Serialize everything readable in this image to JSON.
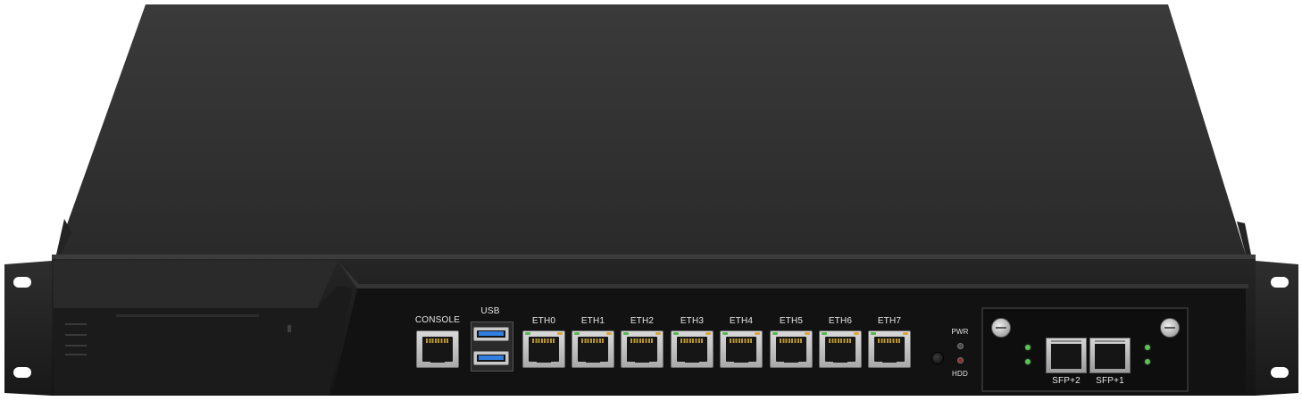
{
  "device": {
    "port_labels": {
      "console": "CONSOLE",
      "usb": "USB",
      "eth": [
        "ETH0",
        "ETH1",
        "ETH2",
        "ETH3",
        "ETH4",
        "ETH5",
        "ETH6",
        "ETH7"
      ],
      "pwr": "PWR",
      "hdd": "HDD",
      "sfp": [
        "SFP+2",
        "SFP+1"
      ]
    },
    "colors": {
      "chassis": "#2b2b2b",
      "front_panel": "#1c1c1c",
      "usb_blue": "#2f7ee0",
      "link_led_green": "#57b84f",
      "activity_led_orange": "#d9a441"
    }
  }
}
